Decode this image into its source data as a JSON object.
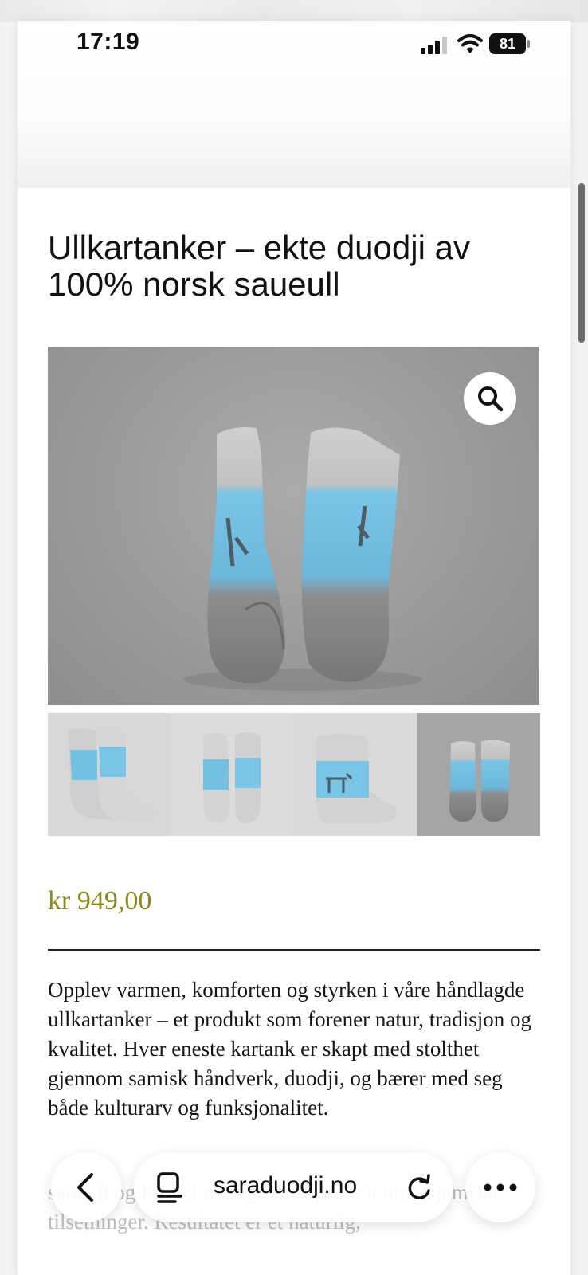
{
  "status_bar": {
    "time": "17:19",
    "battery_level": "81",
    "icons": [
      "signal-icon",
      "wifi-icon",
      "battery-icon"
    ]
  },
  "product": {
    "title": "Ullkartanker – ekte duodji av 100% norsk saueull",
    "price": "kr 949,00",
    "description": "Opplev varmen, komforten og styrken i våre håndlagde ullkartanker – et produkt som forener natur, tradisjon og kvalitet. Hver eneste kartank er skapt med stolthet gjennom samisk håndverk, duodji, og bærer med seg både kulturarv og funksjonalitet.",
    "description_continued": "saueull og formet med grønnsåpe, helt uten kjemiske tilsetninger. Resultatet er et naturlig,",
    "accent_color": "#8c8a1c"
  },
  "gallery": {
    "zoom_icon": "magnifier-icon",
    "thumbnails": 4,
    "selected_thumbnail": 4
  },
  "browser": {
    "address": "saraduodji.no",
    "icons": [
      "back-icon",
      "reader-icon",
      "reload-icon",
      "more-icon"
    ]
  }
}
